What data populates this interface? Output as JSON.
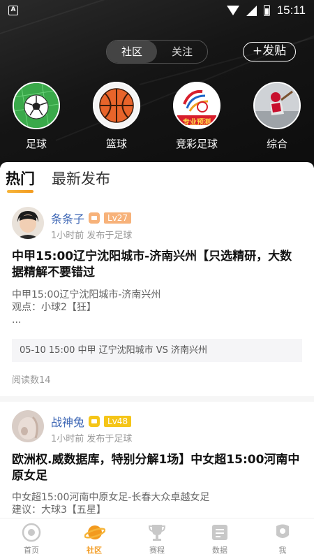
{
  "status_bar": {
    "time": "15:11",
    "app_badge": "A"
  },
  "header": {
    "segments": [
      "社区",
      "关注"
    ],
    "active_segment": 0,
    "post_button": "+发贴"
  },
  "categories": [
    {
      "label": "足球",
      "icon": "soccer-ball-icon"
    },
    {
      "label": "篮球",
      "icon": "basketball-icon"
    },
    {
      "label": "竞彩足球",
      "icon": "lottery-soccer-icon",
      "logo_text": "专业预测"
    },
    {
      "label": "综合",
      "icon": "general-sports-icon"
    }
  ],
  "feed_tabs": {
    "hot": "热门",
    "latest": "最新发布"
  },
  "posts": [
    {
      "username": "条条子",
      "level": "Lv27",
      "level_color": "#f7b27a",
      "meta": "1小时前 发布于足球",
      "title": "中甲15:00辽宁沈阳城市-济南兴州【只选精研，大数据精解不要错过",
      "body_lines": [
        "中甲15:00辽宁沈阳城市-济南兴州",
        "观点：小球2【狂】",
        "..."
      ],
      "match": "05-10 15:00 中甲 辽宁沈阳城市 VS 济南兴州",
      "reads": "阅读数14"
    },
    {
      "username": "战神兔",
      "level": "Lv48",
      "level_color": "#f5c518",
      "meta": "1小时前 发布于足球",
      "title": "欧洲权.威数据库，特别分解1场】中女超15:00河南中原女足",
      "body_lines": [
        "中女超15:00河南中原女足-长春大众卓越女足",
        "建议：大球3【五星】"
      ]
    }
  ],
  "bottom_nav": [
    {
      "label": "首页",
      "icon": "home-icon",
      "active": false
    },
    {
      "label": "社区",
      "icon": "planet-icon",
      "active": true
    },
    {
      "label": "赛程",
      "icon": "trophy-icon",
      "active": false
    },
    {
      "label": "数据",
      "icon": "data-icon",
      "active": false
    },
    {
      "label": "我",
      "icon": "profile-icon",
      "active": false
    }
  ],
  "colors": {
    "accent": "#f39a1e",
    "username": "#3e67b5",
    "header_bg": "#151515"
  }
}
